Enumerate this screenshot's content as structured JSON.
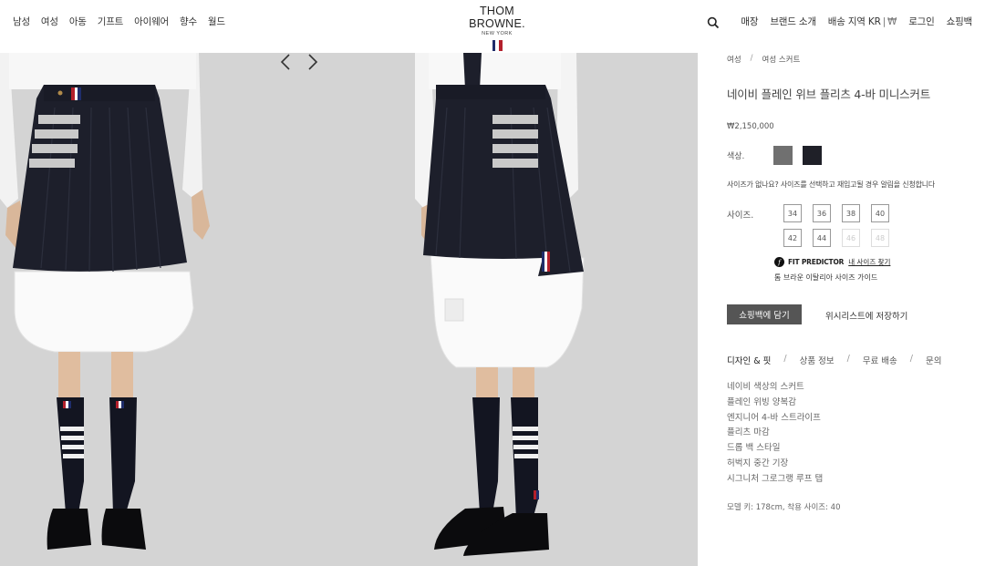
{
  "header": {
    "nav_left": [
      "남성",
      "여성",
      "아동",
      "기프트",
      "아이웨어",
      "향수",
      "월드"
    ],
    "logo_main": "THOM BROWNE.",
    "logo_sub": "NEW YORK",
    "flag_colors": [
      "#1f2d6b",
      "#ffffff",
      "#b3202c"
    ],
    "nav_right": {
      "stores": "매장",
      "brand": "브랜드 소개",
      "ship_region": "배송 지역 KR",
      "sep": "|",
      "currency": "₩",
      "login": "로그인",
      "bag": "쇼핑백"
    }
  },
  "gallery": {
    "prev_icon": "chevron-left-icon",
    "next_icon": "chevron-right-icon"
  },
  "product": {
    "breadcrumb": [
      "여성",
      "여성 스커트"
    ],
    "breadcrumb_sep": "/",
    "title": "네이비 플레인 위브 플리츠 4-바 미니스커트",
    "price": "₩2,150,000",
    "color_label": "색상.",
    "colors": [
      "#707070",
      "#1f2028"
    ],
    "size_note": "사이즈가 없나요? 사이즈를 선택하고 재입고될 경우 알림을 신청합니다",
    "size_label": "사이즈.",
    "sizes": [
      {
        "label": "34",
        "available": true
      },
      {
        "label": "36",
        "available": true
      },
      {
        "label": "38",
        "available": true
      },
      {
        "label": "40",
        "available": true
      },
      {
        "label": "42",
        "available": true
      },
      {
        "label": "44",
        "available": true
      },
      {
        "label": "46",
        "available": false
      },
      {
        "label": "48",
        "available": false
      }
    ],
    "fit_predictor_icon": "f",
    "fit_predictor": "FIT PREDICTOR",
    "fit_link": "내 사이즈 찾기",
    "size_guide": "톰 브라운 이탈리아 사이즈 가이드",
    "add_to_bag": "쇼핑백에 담기",
    "wishlist": "위시리스트에 저장하기",
    "tabs": [
      "디자인 & 핏",
      "상품 정보",
      "무료 배송",
      "문의"
    ],
    "tab_sep": "/",
    "features": [
      "네이비 색상의 스커트",
      "플레인 위빙 양복감",
      "엔지니어 4-바 스트라이프",
      "플리츠 마감",
      "드롭 백 스타일",
      "허벅지 중간 기장",
      "시그니처 그로그랭 루프 탭"
    ],
    "model_info": "모델 키: 178cm, 착용 사이즈: 40"
  }
}
